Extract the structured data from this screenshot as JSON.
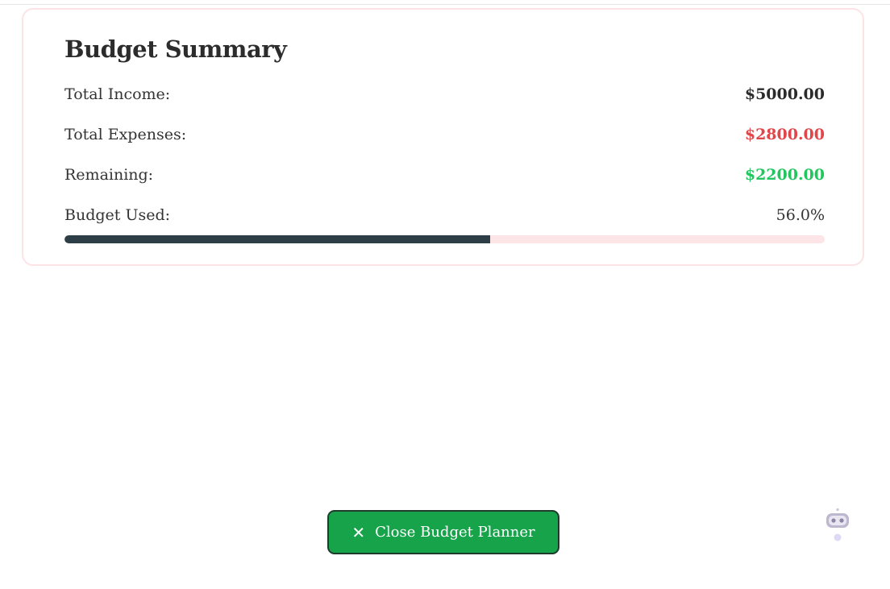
{
  "summary": {
    "title": "Budget Summary",
    "rows": [
      {
        "label": "Total Income:",
        "value": "$5000.00"
      },
      {
        "label": "Total Expenses:",
        "value": "$2800.00"
      },
      {
        "label": "Remaining:",
        "value": "$2200.00"
      },
      {
        "label": "Budget Used:",
        "value": "56.0%"
      }
    ],
    "budget_used_fraction": 0.56
  },
  "close_button": {
    "label": "Close Budget Planner",
    "icon": "close-icon"
  },
  "assistant": {
    "icon": "robot-icon"
  },
  "colors": {
    "expenses": "#e0464a",
    "remaining": "#22c55e",
    "progress_fill": "#2d3e47",
    "progress_track": "#fde4e7",
    "button": "#16a34a"
  }
}
